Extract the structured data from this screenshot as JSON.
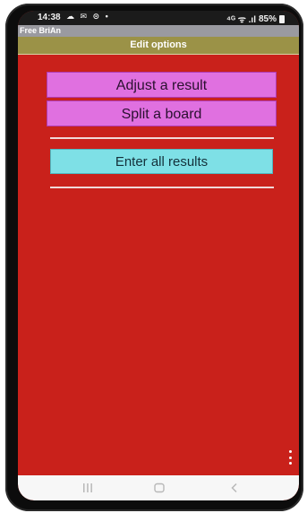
{
  "status_bar": {
    "time": "14:38",
    "left_icons": "☁ ✉ ⊙ •",
    "signal_text": "⁴ᴳ ᯤ .ıl",
    "battery": "85%"
  },
  "app": {
    "name": "Free BriAn",
    "title": "Edit options"
  },
  "options": {
    "adjust_label": "Adjust a result",
    "split_label": "Split a board",
    "enter_all_label": "Enter all results"
  },
  "colors": {
    "background": "#c9211b",
    "title_bar": "#9b9247",
    "option_button": "#e070e0",
    "enter_button": "#7ee0e6"
  },
  "icons": {
    "overflow_menu": "more-vertical-icon",
    "nav_recents": "recents-icon",
    "nav_home": "home-icon",
    "nav_back": "back-icon"
  }
}
